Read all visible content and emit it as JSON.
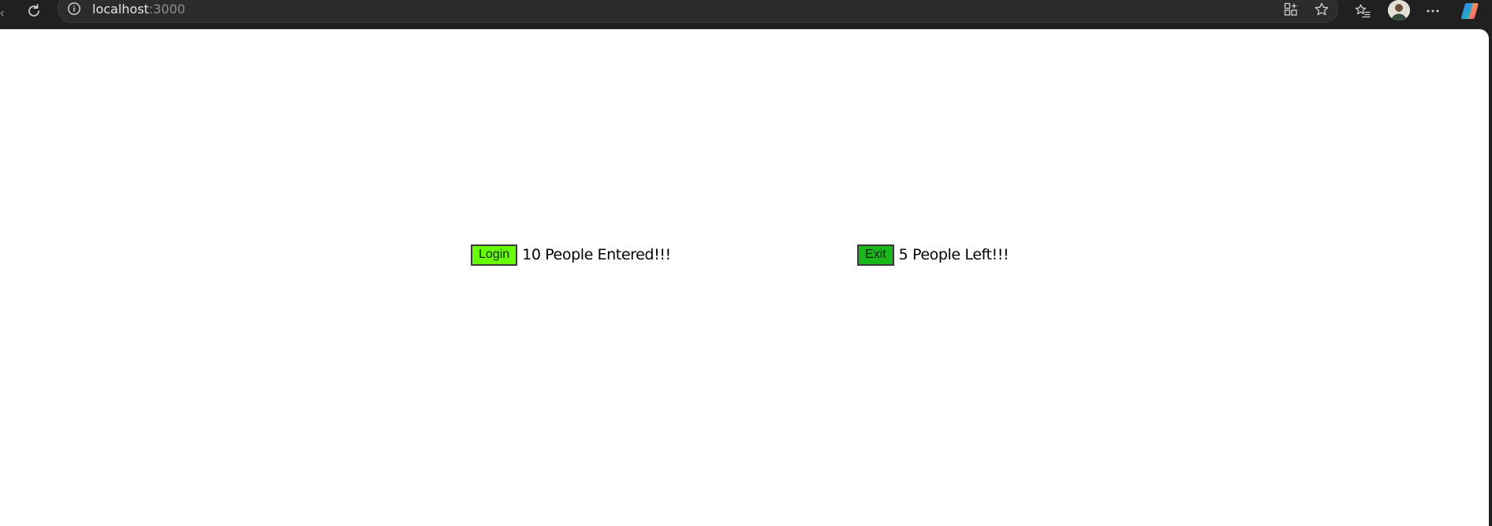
{
  "browser": {
    "url_host": "localhost",
    "url_port": ":3000"
  },
  "app": {
    "login": {
      "button_label": "Login",
      "count_text": "10 People Entered!!!",
      "color": "#66ff00"
    },
    "exit": {
      "button_label": "Exit",
      "count_text": "5 People Left!!!",
      "color": "#17b817"
    }
  },
  "icons": {
    "reload": "reload-icon",
    "site_info": "info-icon",
    "app_available": "app-available-icon",
    "favorite": "star-icon",
    "favorites": "favorites-icon",
    "profile": "avatar",
    "more": "more-icon",
    "copilot": "copilot-icon"
  }
}
